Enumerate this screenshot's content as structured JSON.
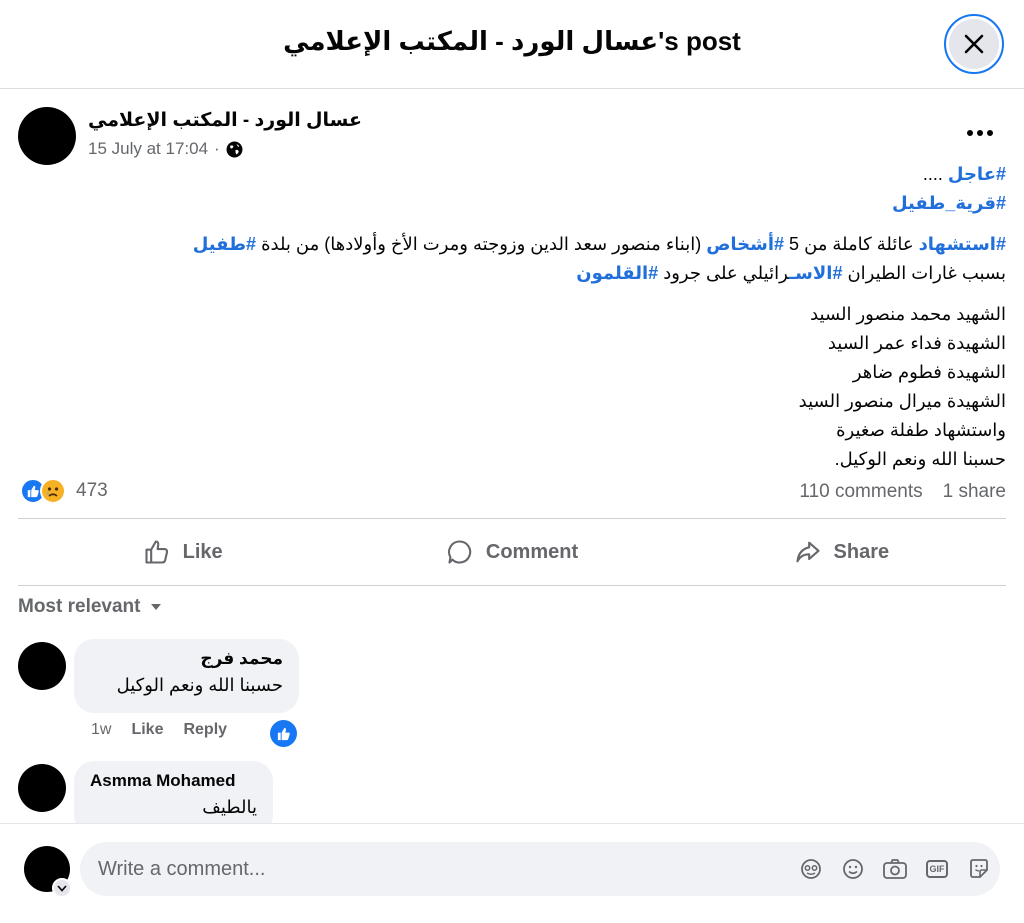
{
  "header": {
    "title": "عسال الورد - المكتب الإعلامي's post",
    "close_icon": "close-icon"
  },
  "post": {
    "author": "عسال الورد - المكتب الإعلامي",
    "timestamp": "15 July at 17:04",
    "separator": "·",
    "audience_icon": "globe-icon",
    "lines": {
      "l1": {
        "hash": "#عاجل",
        "text": " ...."
      },
      "l2": {
        "hash": "#قرية_طفيل"
      },
      "l3": {
        "hash1": "#استشهاد",
        "t1": " عائلة كاملة من 5 ",
        "hash2": "#أشخاص",
        "t2": " (ابناء  منصور سعد الدين وزوجته  ومرت الأخ وأولادها) من بلدة ",
        "hash3": "#طفيل"
      },
      "l4": {
        "t1": "بسبب غارات  الطيران ",
        "hash1": "#الاسـ",
        "t2": "رائيلي على جرود ",
        "hash2": "#القلمون"
      },
      "names": [
        "الشهيد محمد منصور السيد",
        "الشهيدة فداء عمر السيد",
        "الشهيدة فطوم ضاهر",
        "الشهيدة ميرال منصور السيد",
        "واستشهاد طفلة صغيرة",
        "حسبنا الله ونعم الوكيل."
      ]
    },
    "reactions": {
      "count": "473",
      "icons": [
        "like-reaction-icon",
        "sad-reaction-icon"
      ],
      "colors": {
        "like": "#1877f2",
        "sad": "#f7b125"
      }
    },
    "comments_count": "110 comments",
    "shares_count": "1 share"
  },
  "actions": {
    "like": "Like",
    "comment": "Comment",
    "share": "Share"
  },
  "comments_section": {
    "sort_label": "Most relevant",
    "comments": [
      {
        "name": "محمد فرج",
        "text": "حسبنا الله ونعم الوكيل",
        "time": "1w",
        "like": "Like",
        "reply": "Reply"
      },
      {
        "name": "Asmma Mohamed",
        "text": "يالطيف"
      }
    ]
  },
  "composer": {
    "placeholder": "Write a comment...",
    "icons": [
      "avatar-sticker-icon",
      "emoji-icon",
      "camera-icon",
      "gif-icon",
      "sticker-icon"
    ],
    "gif_label": "GIF"
  },
  "colors": {
    "accent": "#1877f2",
    "hashtag": "#216fdb",
    "secondary_text": "#65676b",
    "bubble": "#f0f2f5"
  }
}
